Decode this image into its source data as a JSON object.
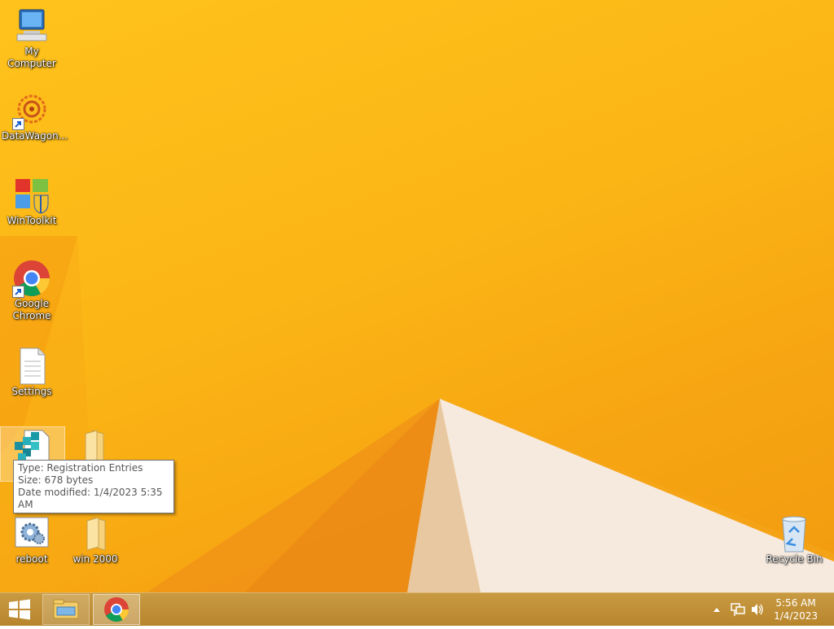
{
  "desktop_icons": {
    "my_computer": {
      "label": "My Computer"
    },
    "datawagon": {
      "label": "DataWagon..."
    },
    "wintoolkit": {
      "label": "WinToolkit"
    },
    "chrome": {
      "label_line1": "Google",
      "label_line2": "Chrome"
    },
    "settings": {
      "label": "Settings"
    },
    "reboot": {
      "label": "reboot"
    },
    "win2000": {
      "label": "win 2000"
    },
    "recycle_bin": {
      "label": "Recycle Bin"
    }
  },
  "tooltip": {
    "type": "Type: Registration Entries",
    "size": "Size: 678 bytes",
    "modified": "Date modified: 1/4/2023 5:35 AM"
  },
  "taskbar": {
    "clock_time": "5:56 AM",
    "clock_date": "1/4/2023",
    "pinned": [
      "folder-icon",
      "chrome-icon"
    ]
  },
  "colors": {
    "wallpaper_orange": "#fbb515",
    "taskbar": "#c0903a"
  }
}
